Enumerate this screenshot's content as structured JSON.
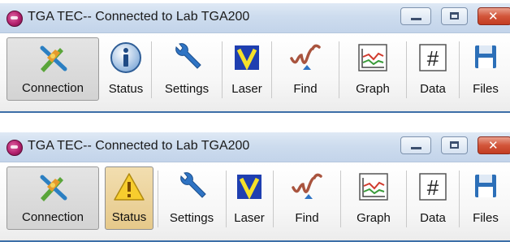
{
  "windows": [
    {
      "title": "TGA TEC-- Connected to Lab TGA200",
      "status_variant": "info",
      "toolbar": [
        {
          "label": "Connection",
          "icon": "connection-icon"
        },
        {
          "label": "Status",
          "icon": "info-icon"
        },
        {
          "label": "Settings",
          "icon": "wrench-icon"
        },
        {
          "label": "Laser",
          "icon": "laser-icon"
        },
        {
          "label": "Find",
          "icon": "find-peak-icon"
        },
        {
          "label": "Graph",
          "icon": "graph-icon"
        },
        {
          "label": "Data",
          "icon": "data-hash-icon"
        },
        {
          "label": "Files",
          "icon": "floppy-disk-icon"
        }
      ]
    },
    {
      "title": "TGA TEC-- Connected to Lab TGA200",
      "status_variant": "warning",
      "toolbar": [
        {
          "label": "Connection",
          "icon": "connection-icon"
        },
        {
          "label": "Status",
          "icon": "warning-icon"
        },
        {
          "label": "Settings",
          "icon": "wrench-icon"
        },
        {
          "label": "Laser",
          "icon": "laser-icon"
        },
        {
          "label": "Find",
          "icon": "find-peak-icon"
        },
        {
          "label": "Graph",
          "icon": "graph-icon"
        },
        {
          "label": "Data",
          "icon": "data-hash-icon"
        },
        {
          "label": "Files",
          "icon": "floppy-disk-icon"
        }
      ]
    }
  ],
  "colors": {
    "titlebar": "#cddcee",
    "close_button": "#d2553a",
    "warning_highlight": "#e6c98a"
  }
}
